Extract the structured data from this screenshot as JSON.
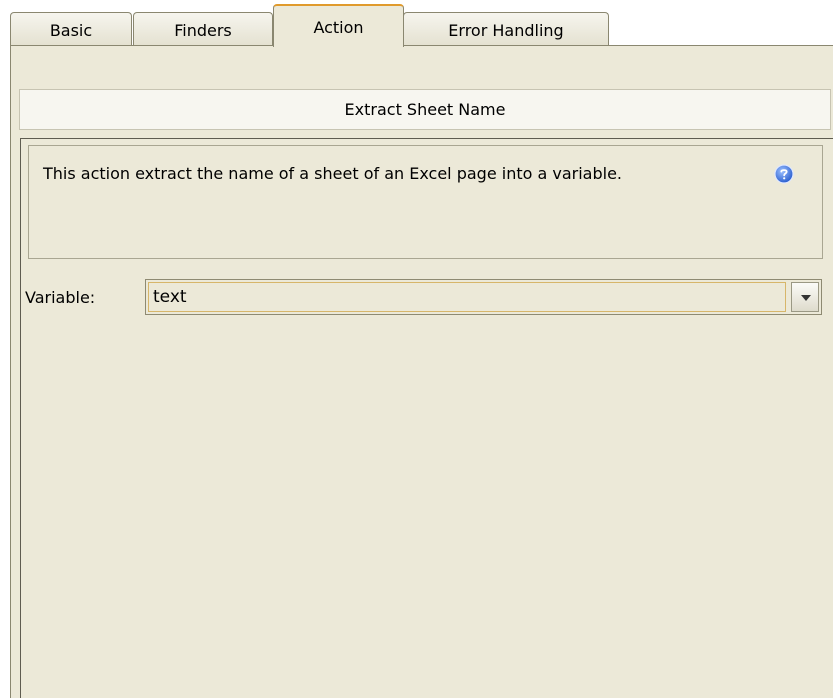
{
  "tabs": [
    {
      "label": "Basic",
      "active": false
    },
    {
      "label": "Finders",
      "active": false
    },
    {
      "label": "Action",
      "active": true
    },
    {
      "label": "Error Handling",
      "active": false
    }
  ],
  "header": {
    "title": "Extract Sheet Name"
  },
  "description": {
    "text": "This action extract the name of a sheet of an Excel page into a variable.",
    "icon": "help-icon"
  },
  "variable": {
    "label": "Variable:",
    "value": "text",
    "dropdown_icon": "chevron-down-icon"
  },
  "colors": {
    "panel_bg": "#ece9d8",
    "active_tab_accent": "#e09a2c",
    "help_icon": "#3a6fd8"
  }
}
